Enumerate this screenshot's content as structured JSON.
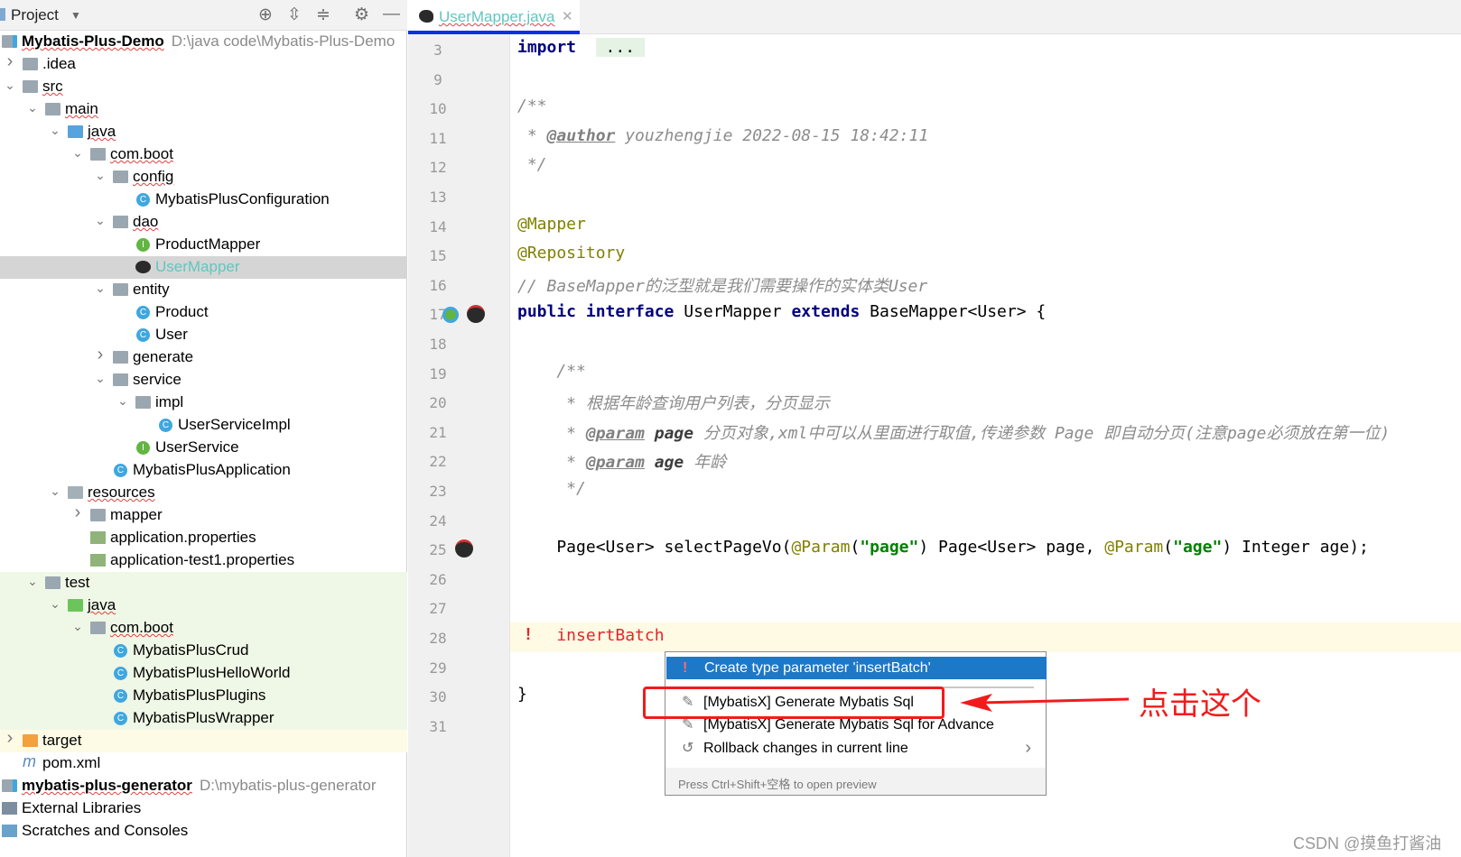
{
  "project_panel": {
    "title": "Project",
    "icons": [
      "locate-icon",
      "expand-all-icon",
      "collapse-all-icon",
      "gear-icon",
      "minimize-icon"
    ]
  },
  "tree": [
    {
      "level": -1,
      "label": "Mybatis-Plus-Demo",
      "path": "D:\\java code\\Mybatis-Plus-Demo",
      "icon": "module",
      "bold": true,
      "arrow": ""
    },
    {
      "level": 0,
      "label": ".idea",
      "icon": "folder",
      "arrow": "collapsed"
    },
    {
      "level": 0,
      "label": "src",
      "icon": "folder",
      "arrow": "expanded"
    },
    {
      "level": 1,
      "label": "main",
      "icon": "folder",
      "arrow": "expanded"
    },
    {
      "level": 2,
      "label": "java",
      "icon": "source-folder",
      "arrow": "expanded"
    },
    {
      "level": 3,
      "label": "com.boot",
      "icon": "package",
      "arrow": "expanded"
    },
    {
      "level": 4,
      "label": "config",
      "icon": "package",
      "arrow": "expanded"
    },
    {
      "level": 5,
      "label": "MybatisPlusConfiguration",
      "icon": "class"
    },
    {
      "level": 4,
      "label": "dao",
      "icon": "package",
      "arrow": "expanded"
    },
    {
      "level": 5,
      "label": "ProductMapper",
      "icon": "interface"
    },
    {
      "level": 5,
      "label": "UserMapper",
      "icon": "mybatis",
      "selected": true
    },
    {
      "level": 4,
      "label": "entity",
      "icon": "package",
      "arrow": "expanded"
    },
    {
      "level": 5,
      "label": "Product",
      "icon": "class"
    },
    {
      "level": 5,
      "label": "User",
      "icon": "class"
    },
    {
      "level": 4,
      "label": "generate",
      "icon": "package",
      "arrow": "collapsed"
    },
    {
      "level": 4,
      "label": "service",
      "icon": "package",
      "arrow": "expanded"
    },
    {
      "level": 5,
      "label": "impl",
      "icon": "package",
      "arrow": "expanded"
    },
    {
      "level": 6,
      "label": "UserServiceImpl",
      "icon": "class"
    },
    {
      "level": 5,
      "label": "UserService",
      "icon": "interface"
    },
    {
      "level": 4,
      "label": "MybatisPlusApplication",
      "icon": "spring-class"
    },
    {
      "level": 2,
      "label": "resources",
      "icon": "resources-folder",
      "arrow": "expanded"
    },
    {
      "level": 3,
      "label": "mapper",
      "icon": "folder",
      "arrow": "collapsed"
    },
    {
      "level": 3,
      "label": "application.properties",
      "icon": "properties"
    },
    {
      "level": 3,
      "label": "application-test1.properties",
      "icon": "properties"
    },
    {
      "level": 1,
      "label": "test",
      "icon": "folder",
      "arrow": "expanded",
      "bg": "test"
    },
    {
      "level": 2,
      "label": "java",
      "icon": "test-folder",
      "arrow": "expanded",
      "bg": "test"
    },
    {
      "level": 3,
      "label": "com.boot",
      "icon": "package",
      "arrow": "expanded",
      "bg": "test"
    },
    {
      "level": 4,
      "label": "MybatisPlusCrud",
      "icon": "test-class",
      "bg": "test"
    },
    {
      "level": 4,
      "label": "MybatisPlusHelloWorld",
      "icon": "test-class",
      "bg": "test"
    },
    {
      "level": 4,
      "label": "MybatisPlusPlugins",
      "icon": "test-class",
      "bg": "test"
    },
    {
      "level": 4,
      "label": "MybatisPlusWrapper",
      "icon": "test-class",
      "bg": "test"
    },
    {
      "level": 0,
      "label": "target",
      "icon": "excluded-folder",
      "arrow": "collapsed",
      "bg": "excluded"
    },
    {
      "level": 0,
      "label": "pom.xml",
      "icon": "maven"
    },
    {
      "level": -1,
      "label": "mybatis-plus-generator",
      "path": "D:\\mybatis-plus-generator",
      "icon": "module",
      "bold": true
    },
    {
      "level": -1,
      "label": "External Libraries",
      "icon": "libraries"
    },
    {
      "level": -1,
      "label": "Scratches and Consoles",
      "icon": "scratches"
    }
  ],
  "editor": {
    "tab_label": "UserMapper.java",
    "lines": [
      {
        "n": "3",
        "t": [
          [
            "kw",
            "import"
          ],
          [
            "",
            "  "
          ],
          [
            "fld",
            " ... "
          ]
        ]
      },
      {
        "n": "9",
        "t": []
      },
      {
        "n": "10",
        "t": [
          [
            "cm",
            "/**"
          ]
        ]
      },
      {
        "n": "11",
        "t": [
          [
            "cm",
            " * "
          ],
          [
            "tag",
            "@author"
          ],
          [
            "cm",
            " youzhengjie 2022-08-15 18:42:11"
          ]
        ]
      },
      {
        "n": "12",
        "t": [
          [
            "cm",
            " */"
          ]
        ]
      },
      {
        "n": "13",
        "t": []
      },
      {
        "n": "14",
        "t": [
          [
            "an",
            "@Mapper"
          ]
        ]
      },
      {
        "n": "15",
        "t": [
          [
            "an",
            "@Repository"
          ]
        ]
      },
      {
        "n": "16",
        "t": [
          [
            "cm",
            "// BaseMapper的泛型就是我们需要操作的实体类User"
          ]
        ]
      },
      {
        "n": "17",
        "t": [
          [
            "kw",
            "public interface "
          ],
          [
            "",
            "UserMapper "
          ],
          [
            "kw",
            "extends "
          ],
          [
            "",
            "BaseMapper<User> {"
          ]
        ]
      },
      {
        "n": "18",
        "t": []
      },
      {
        "n": "19",
        "t": [
          [
            "cm",
            "    /**"
          ]
        ]
      },
      {
        "n": "20",
        "t": [
          [
            "cm",
            "     * 根据年龄查询用户列表，分页显示"
          ]
        ]
      },
      {
        "n": "21",
        "t": [
          [
            "cm",
            "     * "
          ],
          [
            "tag",
            "@param"
          ],
          [
            "cm",
            " "
          ],
          [
            "pn",
            "page"
          ],
          [
            "cm",
            " 分页对象,xml中可以从里面进行取值,传递参数 Page 即自动分页(注意page必须放在第一位)"
          ]
        ]
      },
      {
        "n": "22",
        "t": [
          [
            "cm",
            "     * "
          ],
          [
            "tag",
            "@param"
          ],
          [
            "cm",
            " "
          ],
          [
            "pn",
            "age"
          ],
          [
            "cm",
            " 年龄"
          ]
        ]
      },
      {
        "n": "23",
        "t": [
          [
            "cm",
            "     */"
          ]
        ]
      },
      {
        "n": "24",
        "t": []
      },
      {
        "n": "25",
        "t": [
          [
            "",
            "    Page<User> selectPageVo("
          ],
          [
            "an",
            "@Param"
          ],
          [
            "",
            "("
          ],
          [
            "str",
            "\"page\""
          ],
          [
            "",
            ") Page<User> page, "
          ],
          [
            "an",
            "@Param"
          ],
          [
            "",
            "("
          ],
          [
            "str",
            "\"age\""
          ],
          [
            "",
            ") Integer age);"
          ]
        ]
      },
      {
        "n": "26",
        "t": []
      },
      {
        "n": "27",
        "t": []
      },
      {
        "n": "28",
        "t": [
          [
            "err",
            "    insertBatch"
          ]
        ]
      },
      {
        "n": "29",
        "t": []
      },
      {
        "n": "30",
        "t": [
          [
            "",
            "}"
          ]
        ]
      },
      {
        "n": "31",
        "t": []
      }
    ]
  },
  "popup": {
    "items": [
      {
        "label": "Create type parameter 'insertBatch'",
        "icon": "error-bulb-icon",
        "selected": true
      },
      {
        "label": "[MybatisX] Generate Mybatis Sql",
        "icon": "edit-icon"
      },
      {
        "label": "[MybatisX] Generate Mybatis Sql for Advance",
        "icon": "edit-icon"
      },
      {
        "label": "Rollback changes in current line",
        "icon": "rollback-icon",
        "submenu": true
      }
    ],
    "footer": "Press Ctrl+Shift+空格 to open preview"
  },
  "annotation": {
    "text": "点击这个",
    "color": "#f21b1b"
  },
  "watermark": "CSDN @摸鱼打酱油",
  "colors": {
    "selection": "#1e78c8",
    "keyword": "#000080",
    "annotation": "#808000",
    "string": "#008000",
    "error": "#e3262b",
    "tab_underline": "#0a2ee8"
  }
}
